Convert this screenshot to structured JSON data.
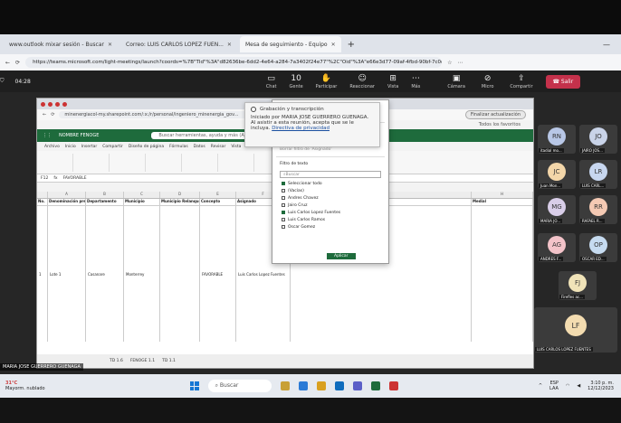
{
  "browser": {
    "tabs": [
      {
        "label": "www.outlook mixar sesión - Buscar",
        "active": false
      },
      {
        "label": "Correo: LUIS CARLOS LOPEZ FUEN...",
        "active": false
      },
      {
        "label": "Mesa de seguimiento - Equipo",
        "active": true
      }
    ],
    "url": "https://teams.microsoft.com/light-meetings/launch?coords=%7B\"TId\"%3A\"d82636be-6dd2-4e64-a284-7a3402f24e77\"%2C\"Oid\"%3A\"e66e3d77-09af-4fbd-90bf-7c0d4a1a7190\"%..."
  },
  "meeting": {
    "timer": "04:28",
    "controls": [
      {
        "label": "Chat",
        "icon": "chat-icon"
      },
      {
        "label": "Gente",
        "icon": "people-icon",
        "count": "10"
      },
      {
        "label": "Participar",
        "icon": "raise-hand-icon"
      },
      {
        "label": "Reaccionar",
        "icon": "react-icon"
      },
      {
        "label": "Vista",
        "icon": "view-icon"
      },
      {
        "label": "Más",
        "icon": "more-icon"
      }
    ],
    "controls_right": [
      {
        "label": "Cámara",
        "icon": "camera-off-icon"
      },
      {
        "label": "Micro",
        "icon": "mic-off-icon"
      },
      {
        "label": "Compartir",
        "icon": "share-icon"
      }
    ],
    "leave_label": "Salir"
  },
  "shared_screen": {
    "url": "minenergiacol-my.sharepoint.com/:x:/r/personal/ingeniero_minenergia_gov...",
    "update_label": "Finalizar actualización",
    "favorites_label": "Todos los favoritos",
    "excel_name": "NOMBRE FENOGE",
    "search_placeholder": "Buscar herramientas, ayuda y más (Alt + Q)",
    "ribbon_tabs": [
      "Archivo",
      "Inicio",
      "Insertar",
      "Compartir",
      "Diseño de página",
      "Fórmulas",
      "Datos",
      "Revisar",
      "Vista",
      "Automatizar",
      "Ayuda",
      "Dibujar"
    ],
    "cell_ref": "F12",
    "formula_value": "FAVORABLE",
    "columns": [
      "No.",
      "Denominación predio",
      "Departamento",
      "Municipio",
      "Municipio Relanquen",
      "Concepto",
      "Asignado",
      "",
      "Medial"
    ],
    "row": {
      "num": "1",
      "predio": "Lote 1",
      "departamento": "Casanare",
      "municipio": "Monterrey",
      "relanquen": "",
      "concepto": "FAVORABLE",
      "asignado": "Luis Carlos Lopez Fuentes"
    },
    "sheet_tabs": [
      "TD 1.6",
      "FENOGE 1.1",
      "TD 1.1"
    ],
    "presenter": "MARIA JOSE GUERRERO GUENAGA"
  },
  "filter_menu": {
    "items": [
      "Ordenar de A a Z",
      "Ordenar de Z a A",
      "Orden personalizado",
      "Vista de hoja",
      "Borrar filtro de 'Asignado'",
      "Filtro de texto"
    ],
    "search_placeholder": "Buscar",
    "options": [
      {
        "label": "Seleccionar todo",
        "checked": true
      },
      {
        "label": "(Vacías)",
        "checked": false
      },
      {
        "label": "Andres Chavez",
        "checked": false
      },
      {
        "label": "Jairo Cruz",
        "checked": false
      },
      {
        "label": "Luis Carlos Lopez Fuentes",
        "checked": true
      },
      {
        "label": "Luis Carlos Ramos",
        "checked": false
      },
      {
        "label": "Oscar Gomez",
        "checked": false
      }
    ],
    "apply_label": "Aplicar"
  },
  "recording_notice": {
    "title": "Grabación y transcripción",
    "body": "Iniciado por MARIA JOSE GUERRERO GUENAGA. Al asistir a esta reunión, acepta que se le incluya.",
    "link": "Directiva de privacidad"
  },
  "participants": [
    {
      "initials": "RN",
      "name": "itadial mo...",
      "color": "#b8c7e6"
    },
    {
      "initials": "JO",
      "name": "JAIRO JOS...",
      "color": "#c9d3e8"
    },
    {
      "initials": "JC",
      "name": "Juan Mon...",
      "color": "#f3d6a9"
    },
    {
      "initials": "LR",
      "name": "LUIS CARL...",
      "color": "#c7d6ef"
    },
    {
      "initials": "MG",
      "name": "MARIA JO...",
      "color": "#d8cde8"
    },
    {
      "initials": "RR",
      "name": "RAFAEL R...",
      "color": "#f4c9b3"
    },
    {
      "initials": "AG",
      "name": "ANDRES F...",
      "color": "#f3c3c9"
    },
    {
      "initials": "OP",
      "name": "OSCAR ED...",
      "color": "#c6dbf0"
    },
    {
      "initials": "FJ",
      "name": "Firefles ac...",
      "color": "#f0e3b8"
    }
  ],
  "self_tile": {
    "initials": "LF",
    "name": "LUIS CARLOS LOPEZ FUENTES",
    "color": "#f3dcb0"
  },
  "taskbar": {
    "weather_temp": "31°C",
    "weather_desc": "Mayorm. nublado",
    "search_label": "Buscar",
    "lang": "ESP",
    "lang2": "LAA",
    "time": "3:10 p. m.",
    "date": "12/12/2023"
  }
}
